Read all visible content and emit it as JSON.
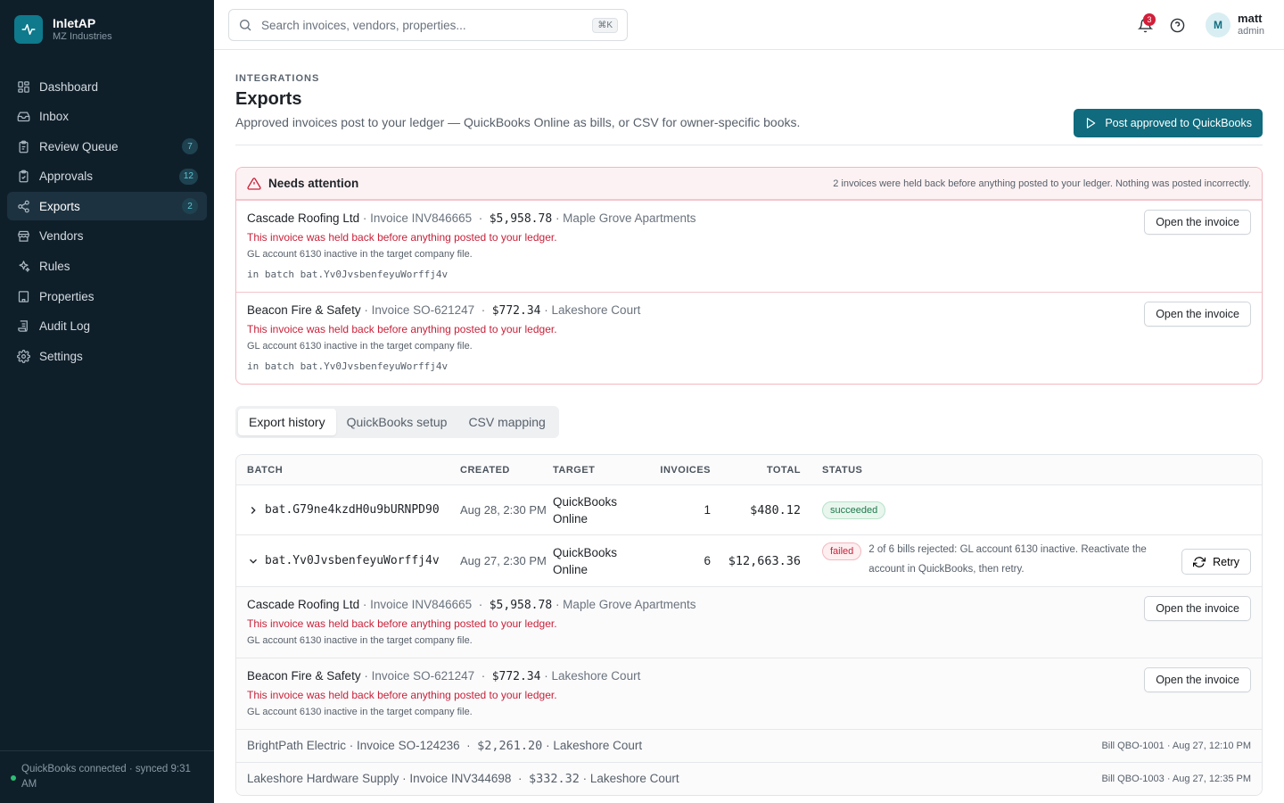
{
  "brand": {
    "name": "InletAP",
    "org": "MZ Industries"
  },
  "nav": [
    {
      "label": "Dashboard",
      "icon": "dashboard-icon",
      "badge": ""
    },
    {
      "label": "Inbox",
      "icon": "inbox-icon",
      "badge": ""
    },
    {
      "label": "Review Queue",
      "icon": "clipboard-icon",
      "badge": "7"
    },
    {
      "label": "Approvals",
      "icon": "clipboard-check-icon",
      "badge": "12"
    },
    {
      "label": "Exports",
      "icon": "share-icon",
      "badge": "2"
    },
    {
      "label": "Vendors",
      "icon": "store-icon",
      "badge": ""
    },
    {
      "label": "Rules",
      "icon": "sparkles-icon",
      "badge": ""
    },
    {
      "label": "Properties",
      "icon": "building-icon",
      "badge": ""
    },
    {
      "label": "Audit Log",
      "icon": "scroll-icon",
      "badge": ""
    },
    {
      "label": "Settings",
      "icon": "gear-icon",
      "badge": ""
    }
  ],
  "sidebar_footer": {
    "status": "QuickBooks connected · synced 9:31 AM"
  },
  "topbar": {
    "search_placeholder": "Search invoices, vendors, properties...",
    "search_shortcut": "⌘K",
    "notification_count": "3",
    "user": {
      "name": "matt",
      "role": "admin",
      "initial": "M"
    }
  },
  "page": {
    "eyebrow": "INTEGRATIONS",
    "title": "Exports",
    "subtitle": "Approved invoices post to your ledger — QuickBooks Online as bills, or CSV for owner-specific books.",
    "post_button": "Post approved to QuickBooks"
  },
  "attention": {
    "title": "Needs attention",
    "note": "2 invoices were held back before anything posted to your ledger. Nothing was posted incorrectly.",
    "items": [
      {
        "vendor": "Cascade Roofing Ltd",
        "invoice": "· Invoice INV846665",
        "amount": "$5,958.78",
        "property": "· Maple Grove Apartments",
        "error": "This invoice was held back before anything posted to your ledger.",
        "detail": "GL account 6130 inactive in the target company file.",
        "batch": "in batch bat.Yv0JvsbenfeyuWorffj4v",
        "button": "Open the invoice"
      },
      {
        "vendor": "Beacon Fire & Safety",
        "invoice": "· Invoice SO-621247",
        "amount": "$772.34",
        "property": "· Lakeshore Court",
        "error": "This invoice was held back before anything posted to your ledger.",
        "detail": "GL account 6130 inactive in the target company file.",
        "batch": "in batch bat.Yv0JvsbenfeyuWorffj4v",
        "button": "Open the invoice"
      }
    ]
  },
  "tabs": [
    "Export history",
    "QuickBooks setup",
    "CSV mapping"
  ],
  "history": {
    "columns": [
      "BATCH",
      "CREATED",
      "TARGET",
      "INVOICES",
      "TOTAL",
      "STATUS"
    ],
    "rows": [
      {
        "batch": "bat.G79ne4kzdH0u9bURNPD90",
        "created": "Aug 28, 2:30 PM",
        "target": "QuickBooks Online",
        "invoices": "1",
        "total": "$480.12",
        "status": "succeeded"
      },
      {
        "batch": "bat.Yv0JvsbenfeyuWorffj4v",
        "created": "Aug 27, 2:30 PM",
        "target": "QuickBooks Online",
        "invoices": "6",
        "total": "$12,663.36",
        "status": "failed",
        "message": "2 of 6 bills rejected: GL account 6130 inactive. Reactivate the account in QuickBooks, then retry.",
        "retry": "Retry"
      }
    ],
    "expanded_failed": [
      {
        "vendor": "Cascade Roofing Ltd",
        "invoice": "· Invoice INV846665",
        "amount": "$5,958.78",
        "property": "· Maple Grove Apartments",
        "error": "This invoice was held back before anything posted to your ledger.",
        "detail": "GL account 6130 inactive in the target company file.",
        "button": "Open the invoice"
      },
      {
        "vendor": "Beacon Fire & Safety",
        "invoice": "· Invoice SO-621247",
        "amount": "$772.34",
        "property": "· Lakeshore Court",
        "error": "This invoice was held back before anything posted to your ledger.",
        "detail": "GL account 6130 inactive in the target company file.",
        "button": "Open the invoice"
      }
    ],
    "expanded_ok": [
      {
        "line": "BrightPath Electric · Invoice SO-124236",
        "amount": "$2,261.20",
        "property": "· Lakeshore Court",
        "bill": "Bill QBO-1001 · Aug 27, 12:10 PM"
      },
      {
        "line": "Lakeshore Hardware Supply · Invoice INV344698",
        "amount": "$332.32",
        "property": "· Lakeshore Court",
        "bill": "Bill QBO-1003 · Aug 27, 12:35 PM"
      }
    ]
  },
  "colors": {
    "sidebar_bg": "#0f1f2a",
    "accent": "#0f6b7d",
    "danger": "#c8223a",
    "success": "#1c7a4a"
  }
}
